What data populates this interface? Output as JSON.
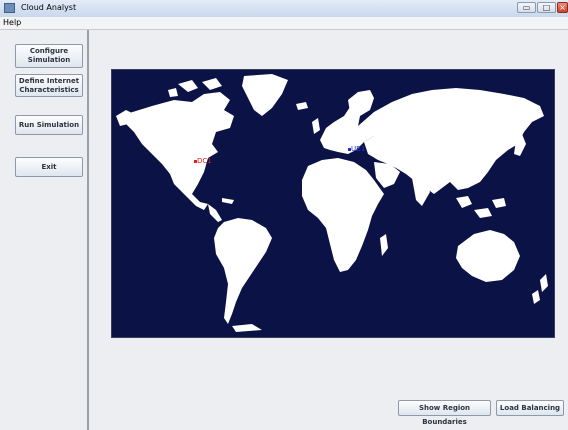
{
  "window": {
    "title": "Cloud Analyst",
    "minimize_label": "▭",
    "maximize_label": "□",
    "close_label": "×"
  },
  "menu": {
    "help": "Help"
  },
  "nav": {
    "configure": "Configure\nSimulation",
    "internet": "Define Internet\nCharacteristics",
    "run": "Run Simulation",
    "exit": "Exit"
  },
  "map": {
    "markers": [
      {
        "id": "dc1",
        "label": "DC1",
        "color": "#e02020"
      },
      {
        "id": "ub1",
        "label": "UB1",
        "color": "#2030d0"
      }
    ],
    "ocean_color": "#0b1246",
    "land_color": "#ffffff"
  },
  "bottom": {
    "regions": "Show Region Boundaries",
    "load": "Load Balancing"
  }
}
